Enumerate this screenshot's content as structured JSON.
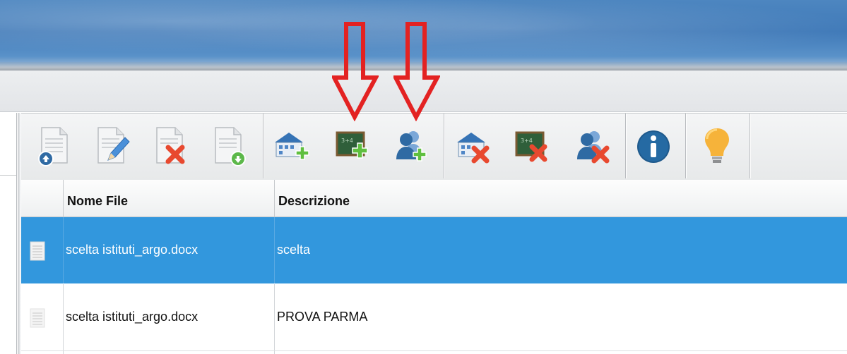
{
  "toolbar": {
    "groups": [
      {
        "buttons": [
          {
            "icon": "document-upload-icon"
          },
          {
            "icon": "document-edit-icon"
          },
          {
            "icon": "document-delete-icon"
          },
          {
            "icon": "document-download-icon"
          }
        ]
      },
      {
        "buttons": [
          {
            "icon": "school-add-icon"
          },
          {
            "icon": "classroom-add-icon"
          },
          {
            "icon": "users-add-icon"
          }
        ]
      },
      {
        "buttons": [
          {
            "icon": "school-remove-icon"
          },
          {
            "icon": "classroom-remove-icon"
          },
          {
            "icon": "users-remove-icon"
          }
        ]
      },
      {
        "buttons": [
          {
            "icon": "info-icon"
          }
        ]
      },
      {
        "buttons": [
          {
            "icon": "lightbulb-icon"
          }
        ]
      }
    ]
  },
  "table": {
    "columns": [
      "Nome File",
      "Descrizione"
    ],
    "rows": [
      {
        "file": "scelta istituti_argo.docx",
        "description": "scelta",
        "selected": true
      },
      {
        "file": "scelta istituti_argo.docx",
        "description": "PROVA PARMA",
        "selected": false
      }
    ]
  },
  "colors": {
    "selection": "#3297dd",
    "annotation_arrow": "#e32222",
    "banner": "#3f79b8"
  }
}
